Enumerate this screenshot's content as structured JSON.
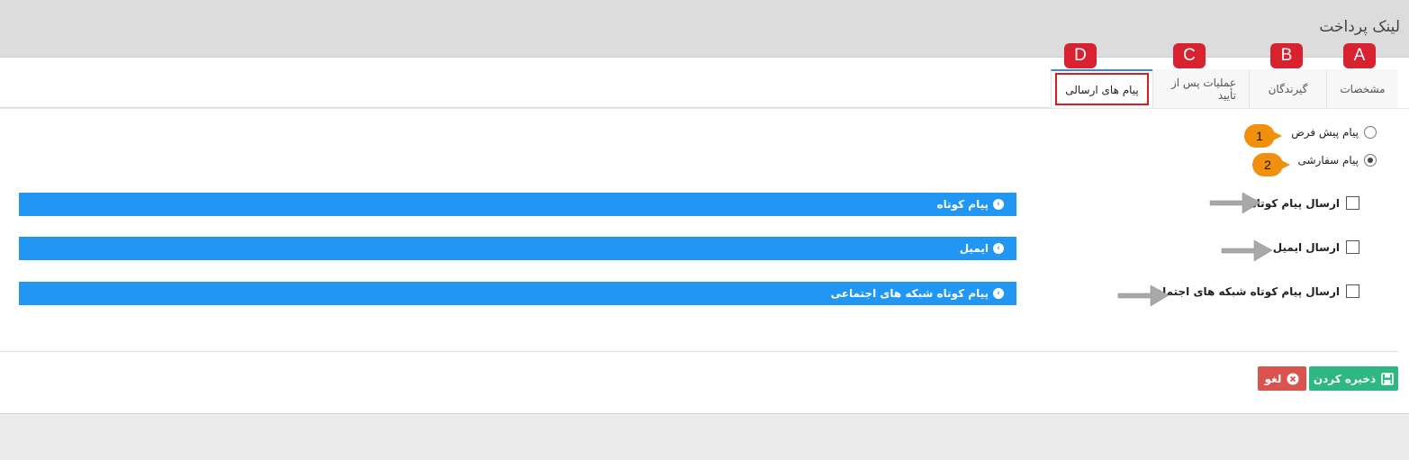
{
  "page": {
    "title": "لینک پرداخت"
  },
  "tabs": [
    {
      "label": "مشخصات",
      "letter": "A"
    },
    {
      "label": "گیرندگان",
      "letter": "B"
    },
    {
      "label": "عملیات پس از تأیید",
      "letter": "C"
    },
    {
      "label": "پیام های ارسالی",
      "letter": "D",
      "active": true
    }
  ],
  "message_type": {
    "options": [
      {
        "label": "پیام پیش فرض",
        "checked": false,
        "badge": "1"
      },
      {
        "label": "پیام سفارشی",
        "checked": true,
        "badge": "2"
      }
    ]
  },
  "send_options": [
    {
      "label": "ارسال پیام کوتاه",
      "checked": false,
      "section_title": "پیام کوتاه"
    },
    {
      "label": "ارسال ایمیل",
      "checked": false,
      "section_title": "ایمیل"
    },
    {
      "label": "ارسال پیام کوتاه شبکه های اجتماعی",
      "checked": false,
      "section_title": "پیام کوتاه شبکه های اجتماعی"
    }
  ],
  "actions": {
    "save_label": "ذخیره کردن",
    "cancel_label": "لغو"
  },
  "colors": {
    "accent_blue": "#2196f3",
    "save_green": "#2fb782",
    "cancel_red": "#d9534f",
    "annotation_red": "#d8222f",
    "annotation_orange": "#f0900e"
  },
  "icons": {
    "bar": "chevron-circle-icon",
    "save": "floppy-disk-icon",
    "cancel": "close-circle-icon",
    "annotation_arrow": "arrow-right-icon"
  }
}
